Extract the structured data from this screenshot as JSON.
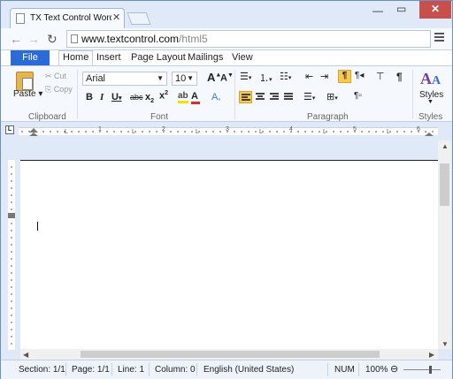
{
  "browser": {
    "tab_title": "TX Text Control Words HT",
    "url_host": "www.textcontrol.com",
    "url_path": "/html5"
  },
  "ribbon": {
    "file_tab": "File",
    "tabs": [
      "Home",
      "Insert",
      "Page Layout",
      "Mailings",
      "View"
    ],
    "active_tab": "Home",
    "clipboard": {
      "paste": "Paste",
      "cut": "Cut",
      "copy": "Copy",
      "label": "Clipboard"
    },
    "font": {
      "family": "Arial",
      "size": "10",
      "label": "Font"
    },
    "paragraph": {
      "label": "Paragraph"
    },
    "styles": {
      "button": "Styles",
      "label": "Styles"
    }
  },
  "ruler": {
    "tab_marker": "L",
    "numbers": [
      "1",
      "2",
      "3",
      "4",
      "5",
      "6"
    ]
  },
  "status": {
    "section": "Section: 1/1",
    "page": "Page: 1/1",
    "line": "Line: 1",
    "column": "Column: 0",
    "language": "English (United States)",
    "num": "NUM",
    "zoom": "100%"
  },
  "colors": {
    "accent": "#2b6bd6",
    "chrome_bg": "#dfe9f7",
    "active_highlight": "#f8c94a"
  }
}
